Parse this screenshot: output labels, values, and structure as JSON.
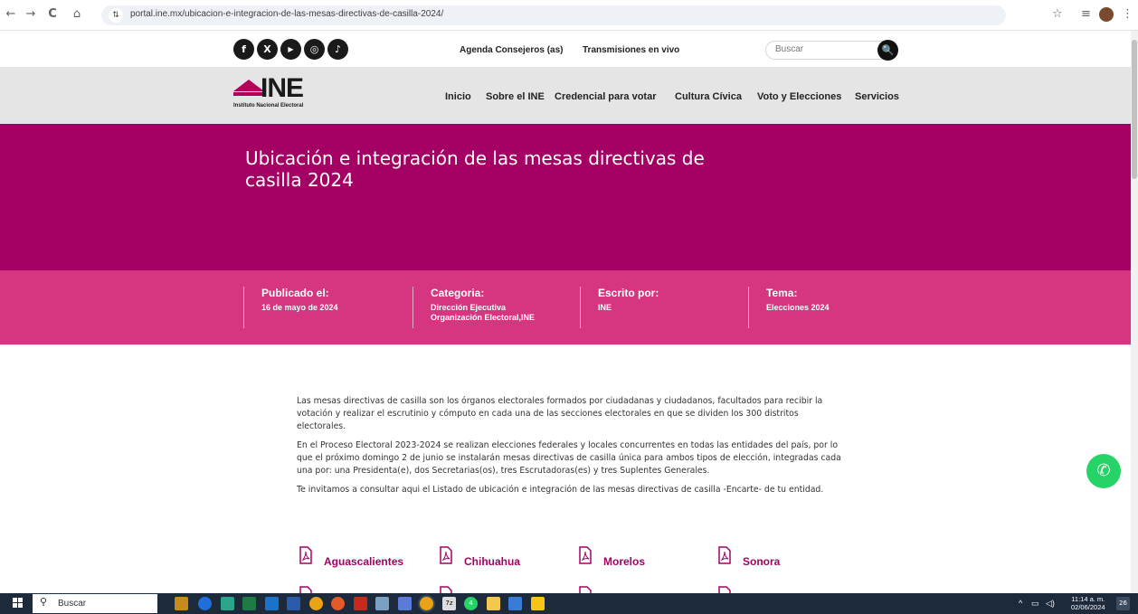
{
  "browser": {
    "url": "portal.ine.mx/ubicacion-e-integracion-de-las-mesas-directivas-de-casilla-2024/",
    "back_icon": "←",
    "forward_icon": "→",
    "reload_icon": "C",
    "home_icon": "⌂",
    "site_settings_icon": "⇅",
    "star_icon": "☆",
    "reading_list_icon": "≡",
    "menu_icon": "⋮"
  },
  "utility_bar": {
    "social": [
      {
        "name": "facebook",
        "glyph": "f"
      },
      {
        "name": "x",
        "glyph": "X"
      },
      {
        "name": "youtube",
        "glyph": "▶"
      },
      {
        "name": "instagram",
        "glyph": "◎"
      },
      {
        "name": "tiktok",
        "glyph": "♪"
      }
    ],
    "links": [
      "Agenda Consejeros (as)",
      "Transmisiones en vivo"
    ],
    "search_placeholder": "Buscar",
    "search_icon": "🔍"
  },
  "brand": {
    "name": "INE",
    "subtitle": "Instituto Nacional Electoral",
    "color": "#b5005b"
  },
  "main_nav": [
    "Inicio",
    "Sobre el INE",
    "Credencial para votar",
    "Cultura Cívica",
    "Voto y Elecciones",
    "Servicios"
  ],
  "hero": {
    "title": "Ubicación e integración de las mesas directivas de casilla 2024",
    "color": "#a50063"
  },
  "meta": [
    {
      "label": "Publicado el:",
      "value": "16 de mayo de 2024"
    },
    {
      "label": "Categoria:",
      "value": "Dirección Ejecutiva Organización Electoral,INE"
    },
    {
      "label": "Escrito por:",
      "value": "INE"
    },
    {
      "label": "Tema:",
      "value": "Elecciones 2024"
    }
  ],
  "content": {
    "paragraphs": [
      "Las mesas directivas de casilla son los órganos electorales formados por ciudadanas y ciudadanos, facultados para recibir la votación y realizar el escrutinio y cómputo en cada una de las secciones electorales en que se dividen los 300 distritos electorales.",
      "En el Proceso Electoral 2023-2024 se realizan elecciones federales y locales concurrentes en todas las entidades del país, por lo que el próximo domingo 2 de junio se instalarán mesas directivas de casilla única para ambos tipos de elección, integradas cada una por: una Presidenta(e), dos Secretarias(os), tres Escrutadoras(es) y tres Suplentes Generales.",
      "Te invitamos a consultar aqui el Listado de ubicación e integración de las mesas directivas de casilla -Encarte- de tu entidad."
    ]
  },
  "states": [
    "Aguascalientes",
    "Chihuahua",
    "Morelos",
    "Sonora"
  ],
  "whatsapp_icon": "✆",
  "taskbar": {
    "search_placeholder": "Buscar",
    "search_icon": "⚲",
    "time": "11:14 a. m.",
    "date": "02/06/2024",
    "notification_count": "26",
    "tray_up_icon": "^",
    "tray_network_icon": "▭",
    "tray_volume_icon": "◁)",
    "whatsapp_badge": "4",
    "calc_badge": "7z"
  }
}
